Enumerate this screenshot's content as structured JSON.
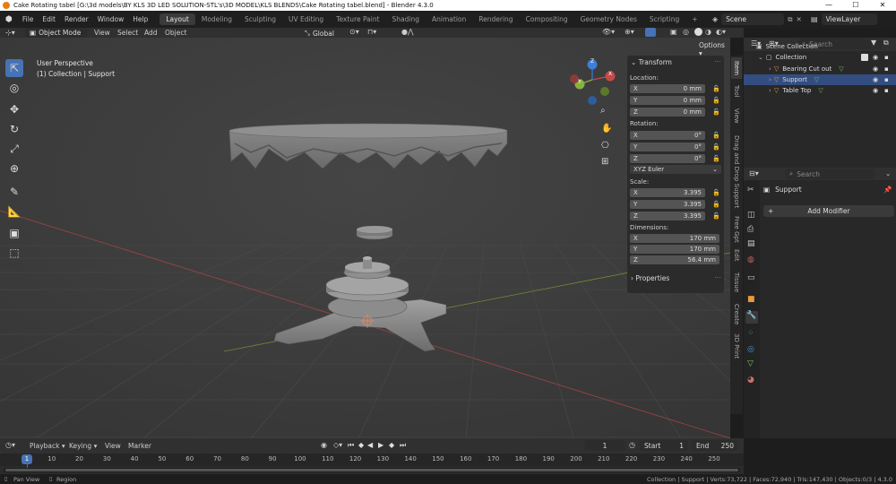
{
  "window": {
    "title": "Cake Rotating tabel [G:\\3d models\\BY KLS 3D LED SOLUTION-STL's\\3D MODEL\\KLS BLENDS\\Cake Rotating tabel.blend] - Blender 4.3.0",
    "minimize": "—",
    "maximize": "☐",
    "close": "✕"
  },
  "menubar": [
    "File",
    "Edit",
    "Render",
    "Window",
    "Help"
  ],
  "workspaces": [
    "Layout",
    "Modeling",
    "Sculpting",
    "UV Editing",
    "Texture Paint",
    "Shading",
    "Animation",
    "Rendering",
    "Compositing",
    "Geometry Nodes",
    "Scripting"
  ],
  "active_workspace": "Layout",
  "add_workspace": "+",
  "scene": {
    "name": "Scene",
    "view_layer": "ViewLayer"
  },
  "viewport_header": {
    "mode": "Object Mode",
    "menus": [
      "View",
      "Select",
      "Add",
      "Object"
    ],
    "orientation": "Global",
    "options": "Options"
  },
  "viewport": {
    "perspective": "User Perspective",
    "collection_path": "(1) Collection | Support",
    "gizmo_axes": {
      "x": "X",
      "y": "Y",
      "z": "Z"
    }
  },
  "npanel": {
    "header": "Transform",
    "location_label": "Location:",
    "location": [
      {
        "axis": "X",
        "value": "0 mm"
      },
      {
        "axis": "Y",
        "value": "0 mm"
      },
      {
        "axis": "Z",
        "value": "0 mm"
      }
    ],
    "rotation_label": "Rotation:",
    "rotation": [
      {
        "axis": "X",
        "value": "0°"
      },
      {
        "axis": "Y",
        "value": "0°"
      },
      {
        "axis": "Z",
        "value": "0°"
      }
    ],
    "rotation_mode": "XYZ Euler",
    "scale_label": "Scale:",
    "scale": [
      {
        "axis": "X",
        "value": "3.395"
      },
      {
        "axis": "Y",
        "value": "3.395"
      },
      {
        "axis": "Z",
        "value": "3.395"
      }
    ],
    "dimensions_label": "Dimensions:",
    "dimensions": [
      {
        "axis": "X",
        "value": "170 mm"
      },
      {
        "axis": "Y",
        "value": "170 mm"
      },
      {
        "axis": "Z",
        "value": "56.4 mm"
      }
    ],
    "properties": "Properties"
  },
  "side_tabs": [
    "Item",
    "Tool",
    "View",
    "Drag and Drop Support",
    "Free Gpt",
    "Edit",
    "Tissue",
    "Create",
    "3D Print"
  ],
  "active_side_tab": "Item",
  "outliner": {
    "search_placeholder": "Search",
    "scene_collection": "Scene Collection",
    "collection": "Collection",
    "objects": [
      "Bearing Cut out",
      "Support",
      "Table Top"
    ]
  },
  "properties": {
    "search_placeholder": "Search",
    "object_name": "Support",
    "add_modifier": "Add Modifier"
  },
  "timeline": {
    "menus": [
      "Playback",
      "Keying",
      "View",
      "Marker"
    ],
    "current_frame": "1",
    "start_label": "Start",
    "start": "1",
    "end_label": "End",
    "end": "250",
    "ticks": [
      "1",
      "10",
      "20",
      "30",
      "40",
      "50",
      "60",
      "70",
      "80",
      "90",
      "100",
      "110",
      "120",
      "130",
      "140",
      "150",
      "160",
      "170",
      "180",
      "190",
      "200",
      "210",
      "220",
      "230",
      "240",
      "250"
    ],
    "playhead": "1"
  },
  "statusbar": {
    "pan_view": "Pan View",
    "region": "Region",
    "stats": "Collection | Support | Verts:73,722 | Faces:72,940 | Tris:147,430 | Objects:0/3 | 4.3.0"
  },
  "colors": {
    "accent": "#4772b3",
    "x_axis": "#c44a4a",
    "y_axis": "#8ab040",
    "z_axis": "#3d7fd6",
    "mesh_icon": "#e89a3c",
    "modifier_icon": "#4a9ad8"
  }
}
